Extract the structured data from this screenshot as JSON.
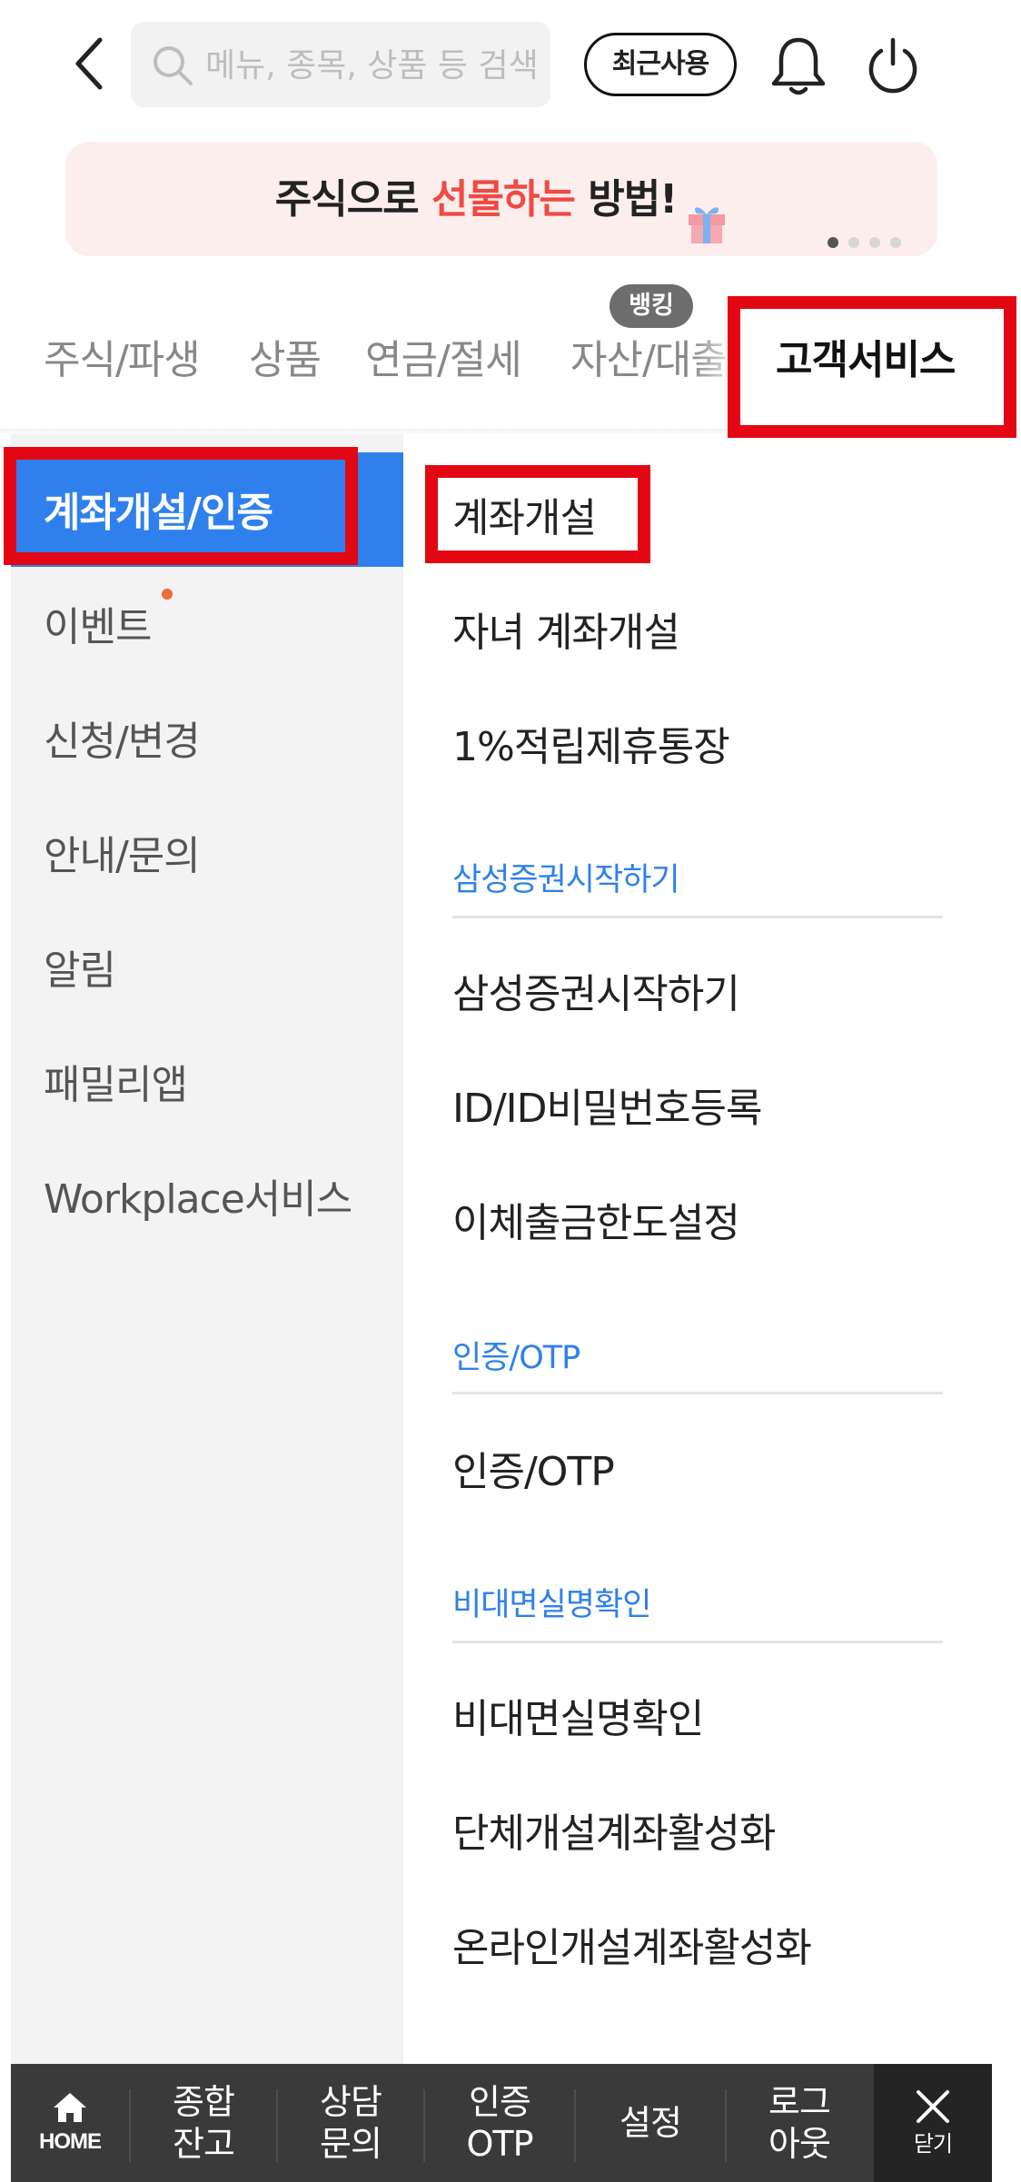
{
  "header": {
    "search_placeholder": "메뉴, 종목, 상품 등 검색",
    "recent_label": "최근사용"
  },
  "banner": {
    "text_before": "주식으로 ",
    "text_highlight": "선물하는",
    "text_after": " 방법!",
    "page_count": 4,
    "active_page": 1
  },
  "tabs": [
    {
      "label": "주식/파생",
      "active": false
    },
    {
      "label": "상품",
      "active": false
    },
    {
      "label": "연금/절세",
      "active": false
    },
    {
      "label": "자산/대출",
      "active": false
    },
    {
      "label": "고객서비스",
      "active": true
    }
  ],
  "tab_badge": "뱅킹",
  "categories": [
    {
      "label": "계좌개설/인증",
      "active": true
    },
    {
      "label": "이벤트",
      "active": false,
      "new": true
    },
    {
      "label": "신청/변경",
      "active": false
    },
    {
      "label": "안내/문의",
      "active": false
    },
    {
      "label": "알림",
      "active": false
    },
    {
      "label": "패밀리앱",
      "active": false
    },
    {
      "label": "Workplace서비스",
      "active": false
    }
  ],
  "menu": {
    "items_top": [
      "계좌개설",
      "자녀 계좌개설",
      "1%적립제휴통장"
    ],
    "section1": {
      "title": "삼성증권시작하기",
      "items": [
        "삼성증권시작하기",
        "ID/ID비밀번호등록",
        "이체출금한도설정"
      ]
    },
    "section2": {
      "title": "인증/OTP",
      "items": [
        "인증/OTP"
      ]
    },
    "section3": {
      "title": "비대면실명확인",
      "items": [
        "비대면실명확인",
        "단체개설계좌활성화",
        "온라인개설계좌활성화"
      ]
    }
  },
  "bottom_bar": {
    "home": "HOME",
    "balance": [
      "종합",
      "잔고"
    ],
    "consult": [
      "상담",
      "문의"
    ],
    "otp": [
      "인증",
      "OTP"
    ],
    "settings": "설정",
    "logout": [
      "로그",
      "아웃"
    ],
    "close": "닫기"
  },
  "colors": {
    "accent_blue": "#2f80ed",
    "highlight_red": "#e30613",
    "banner_bg": "#fdeeee",
    "banner_highlight": "#ef4a43",
    "bottom_bar": "#3a3a3a"
  }
}
